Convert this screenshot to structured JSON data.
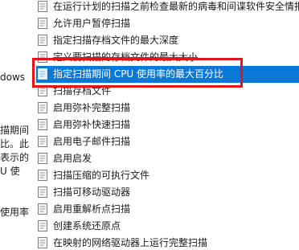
{
  "left_pane": {
    "fragments": [
      "dows",
      "描期间",
      "比。此",
      "表示的",
      "U 使",
      "使用率"
    ]
  },
  "policy_list": {
    "items": [
      {
        "label": "在运行计划的扫描之前检查最新的病毒和间谍软件安全情报"
      },
      {
        "label": "允许用户暂停扫描"
      },
      {
        "label": "指定扫描存档文件的最大深度"
      },
      {
        "label": "定义要扫描的存档文件的最大大小"
      },
      {
        "label": "指定扫描期间 CPU 使用率的最大百分比"
      },
      {
        "label": "扫描存档文件"
      },
      {
        "label": "启用弥补完整扫描"
      },
      {
        "label": "启用弥补快速扫描"
      },
      {
        "label": "启用电子邮件扫描"
      },
      {
        "label": "启用启发"
      },
      {
        "label": "扫描压缩的可执行文件"
      },
      {
        "label": "扫描可移动驱动器"
      },
      {
        "label": "启用重解析点扫描"
      },
      {
        "label": "创建系统还原点"
      },
      {
        "label": "在映射的网络驱动器上运行完整扫描"
      }
    ],
    "selected_index": 4
  },
  "colors": {
    "selection": "#0a78d7",
    "annotation_border": "#e0161b"
  }
}
